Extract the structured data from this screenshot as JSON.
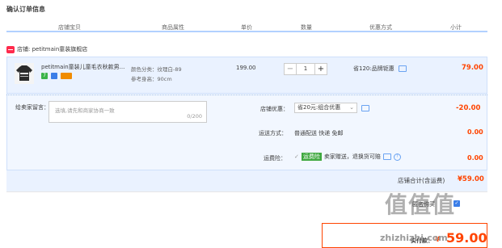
{
  "title": "确认订单信息",
  "columns": [
    "店铺宝贝",
    "商品属性",
    "单价",
    "数量",
    "优惠方式",
    "小计"
  ],
  "shop": {
    "label": "店铺: petitmain童装旗舰店"
  },
  "item": {
    "name": "petitmain童装儿童毛衣秋款男...",
    "attr_color": "颜色分类：纹理白-89",
    "attr_height": "参考身高：90cm",
    "price": "199.00",
    "quantity": "1",
    "discount": "省120:品牌钜惠",
    "subtotal": "79.00",
    "badge_label": "7"
  },
  "message": {
    "label": "给卖家留言：",
    "placeholder": "选填,请先和商家协商一致",
    "counter": "0/200"
  },
  "coupon": {
    "label": "店铺优惠：",
    "value": "省20元:组合优惠",
    "amount": "-20.00"
  },
  "shipping": {
    "label": "运送方式：",
    "value": "普通配送 快递 免邮",
    "amount": "0.00"
  },
  "insurance": {
    "label": "运费险：",
    "tag": "运费险",
    "value": "卖家赠送，退换货可赔",
    "amount": "0.00"
  },
  "shop_total": {
    "label": "店铺合计(含运费)",
    "amount": "¥59.00"
  },
  "footer": {
    "anon_label": "匿名购买",
    "pay_label": "实付款：",
    "pay_currency": "¥",
    "pay_amount": "59.00"
  },
  "watermark": {
    "logo_text": "值值值",
    "url": "zhizhizhi.com"
  },
  "colors": {
    "accent": "#ff4400",
    "light_blue": "#eaf2ff",
    "border_blue": "#b2d1ff",
    "checkbox": "#3b7ee8"
  }
}
